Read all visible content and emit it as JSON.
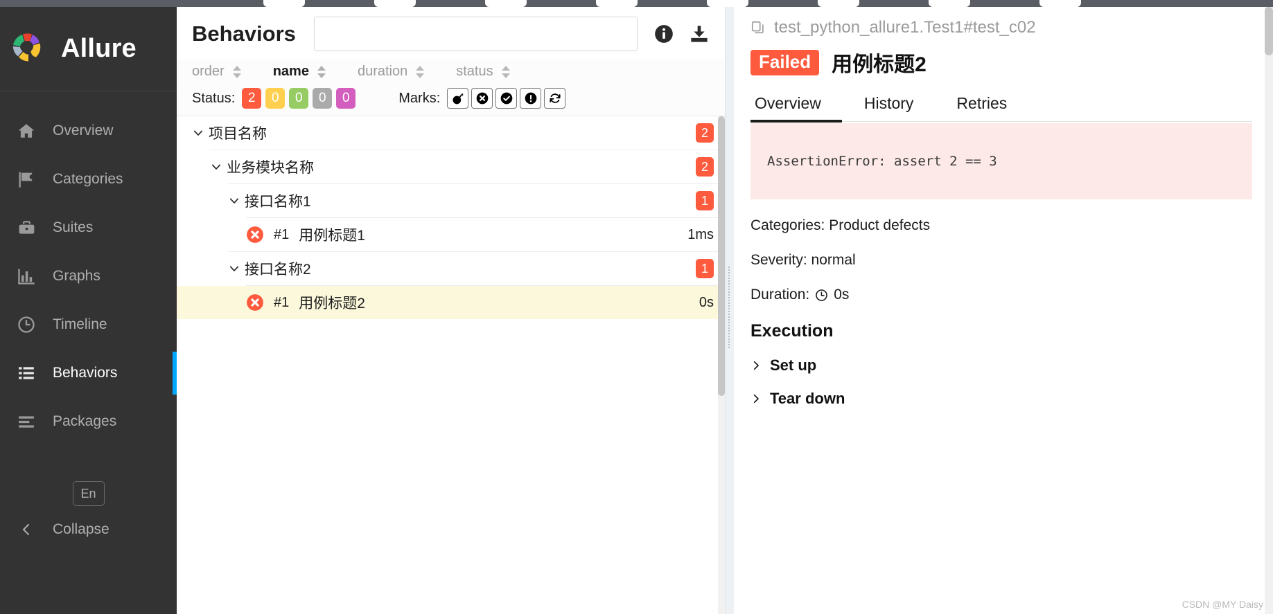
{
  "sidebar": {
    "brand_name": "Allure",
    "items": [
      {
        "label": "Overview",
        "icon": "home-icon",
        "active": false
      },
      {
        "label": "Categories",
        "icon": "flag-icon",
        "active": false
      },
      {
        "label": "Suites",
        "icon": "briefcase-icon",
        "active": false
      },
      {
        "label": "Graphs",
        "icon": "bar-chart-icon",
        "active": false
      },
      {
        "label": "Timeline",
        "icon": "clock-icon",
        "active": false
      },
      {
        "label": "Behaviors",
        "icon": "list-icon",
        "active": true
      },
      {
        "label": "Packages",
        "icon": "layers-icon",
        "active": false
      }
    ],
    "language": "En",
    "collapse_label": "Collapse"
  },
  "tree_panel": {
    "title": "Behaviors",
    "search_value": "",
    "search_placeholder": "",
    "info_icon": "info-icon",
    "download_icon": "download-icon",
    "sort_columns": [
      {
        "label": "order",
        "active": false
      },
      {
        "label": "name",
        "active": true
      },
      {
        "label": "duration",
        "active": false
      },
      {
        "label": "status",
        "active": false
      }
    ],
    "status_label": "Status:",
    "status_chips": [
      {
        "value": "2",
        "color": "#fd5a3e",
        "name": "failed"
      },
      {
        "value": "0",
        "color": "#ffd050",
        "name": "broken"
      },
      {
        "value": "0",
        "color": "#97cc64",
        "name": "passed"
      },
      {
        "value": "0",
        "color": "#aaaaaa",
        "name": "skipped"
      },
      {
        "value": "0",
        "color": "#d35ebe",
        "name": "unknown"
      }
    ],
    "marks_label": "Marks:",
    "marks": [
      {
        "name": "flaky-bomb-icon"
      },
      {
        "name": "failed-x-circle-icon"
      },
      {
        "name": "passed-check-circle-icon"
      },
      {
        "name": "info-exclamation-icon"
      },
      {
        "name": "retry-refresh-icon"
      }
    ],
    "rows": [
      {
        "level": 0,
        "label": "项目名称",
        "badge": "2",
        "type": "group",
        "expanded": true
      },
      {
        "level": 1,
        "label": "业务模块名称",
        "badge": "2",
        "type": "group",
        "expanded": true
      },
      {
        "level": 2,
        "label": "接口名称1",
        "badge": "1",
        "type": "group",
        "expanded": true
      },
      {
        "level": 3,
        "order": "#1",
        "label": "用例标题1",
        "duration": "1ms",
        "type": "case",
        "status": "failed",
        "selected": false
      },
      {
        "level": 2,
        "label": "接口名称2",
        "badge": "1",
        "type": "group",
        "expanded": true
      },
      {
        "level": 3,
        "order": "#1",
        "label": "用例标题2",
        "duration": "0s",
        "type": "case",
        "status": "failed",
        "selected": true
      }
    ]
  },
  "detail_panel": {
    "breadcrumb": "test_python_allure1.Test1#test_c02",
    "copy_icon": "copy-icon",
    "status_badge": "Failed",
    "status_badge_color": "#fd5a3e",
    "title": "用例标题2",
    "tabs": [
      {
        "label": "Overview",
        "active": true
      },
      {
        "label": "History",
        "active": false
      },
      {
        "label": "Retries",
        "active": false
      }
    ],
    "error_message": "AssertionError: assert 2 == 3",
    "categories_line": "Categories: Product defects",
    "severity_line": "Severity: normal",
    "duration_label": "Duration:",
    "duration_value": "0s",
    "duration_icon": "clock-icon",
    "execution_title": "Execution",
    "execution_items": [
      {
        "label": "Set up",
        "expanded": false
      },
      {
        "label": "Tear down",
        "expanded": false
      }
    ]
  },
  "watermark": "CSDN @MY Daisy"
}
